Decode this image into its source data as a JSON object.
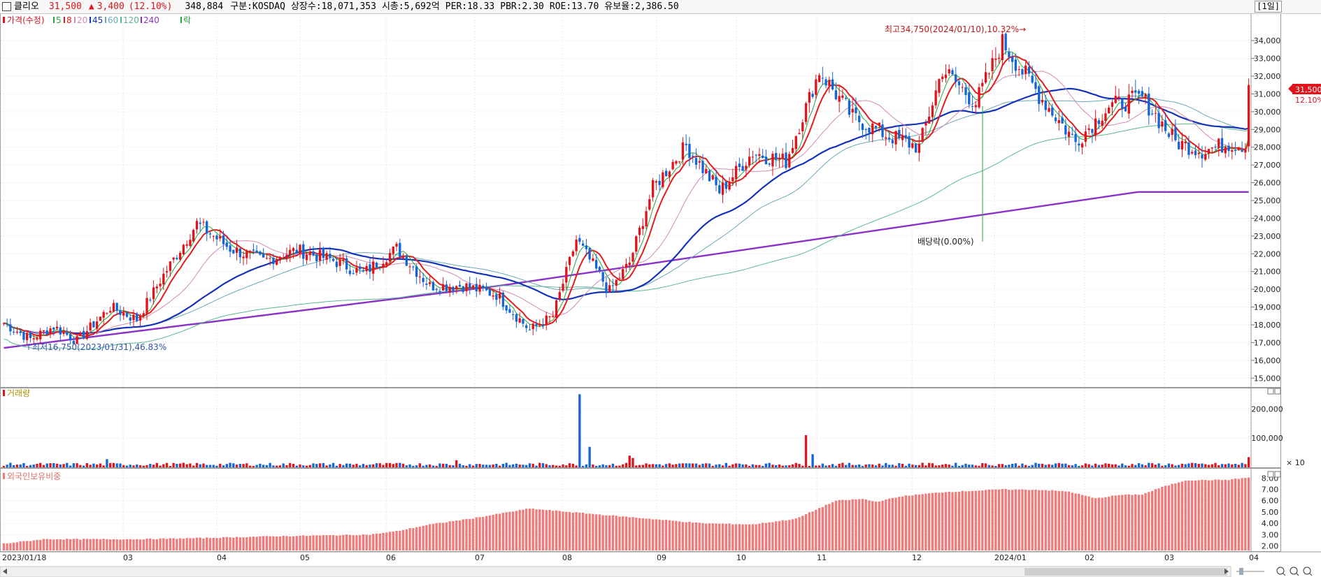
{
  "header": {
    "stock_name": "클리오",
    "price": "31,500",
    "change_arrow": "▲",
    "change": "3,400",
    "change_pct": "(12.10%)",
    "volume": "348,884",
    "market": "구분:KOSDAQ",
    "shares": "상장수:18,071,353",
    "mcap": "시총:5,692억",
    "per": "PER:18.33",
    "pbr": "PBR:2.30",
    "roe": "ROE:13.70",
    "float": "유보율:2,386.50",
    "period": "[1일]"
  },
  "colors": {
    "up": "#e0141c",
    "down": "#1466d6",
    "ma5": "#22a83a",
    "ma8": "#e41c1c",
    "ma20": "#d28ab4",
    "ma45": "#1432b8",
    "ma60": "#6aa8b8",
    "ma120": "#5cb890",
    "ma240": "#8a32c8",
    "foreign": "#f07a7a",
    "grid": "#d8d8d8"
  },
  "legend": {
    "price": "가격(수정)",
    "ma5": "5",
    "ma8": "8",
    "ma20": "20",
    "ma45": "45",
    "ma60": "60",
    "ma120": "120",
    "ma240": "240",
    "drop": "락"
  },
  "annotations": {
    "high": "최고34,750(2024/01/10),10.32%→",
    "low": "↑최저16,750(2023/01/31),46.83%",
    "dividend": "배당락(0.00%)"
  },
  "panels": {
    "volume_title": "거래량",
    "foreign_title": "외국인보유비중",
    "volume_unit": "× 10"
  },
  "chart_data": [
    {
      "type": "candlestick",
      "title": "클리오",
      "y_ticks": [
        "15,000",
        "16,000",
        "17,000",
        "18,000",
        "19,000",
        "20,000",
        "21,000",
        "22,000",
        "23,000",
        "24,000",
        "25,000",
        "26,000",
        "27,000",
        "28,000",
        "29,000",
        "30,000",
        "31,000",
        "32,000",
        "33,000",
        "34,000"
      ],
      "ylim": [
        14500,
        35500
      ],
      "x_ticks": [
        "2023/01/18",
        "03",
        "04",
        "05",
        "06",
        "07",
        "08",
        "09",
        "10",
        "11",
        "12",
        "2024/01",
        "02",
        "03",
        "04"
      ],
      "current_price_label": "31,500",
      "current_pct_label": "12.10%",
      "close_anchors": [
        [
          0,
          18100
        ],
        [
          8,
          17200
        ],
        [
          15,
          17900
        ],
        [
          22,
          17100
        ],
        [
          32,
          19000
        ],
        [
          40,
          18300
        ],
        [
          48,
          20800
        ],
        [
          58,
          23700
        ],
        [
          68,
          22300
        ],
        [
          78,
          21600
        ],
        [
          88,
          22200
        ],
        [
          98,
          21700
        ],
        [
          108,
          20900
        ],
        [
          118,
          22300
        ],
        [
          128,
          20200
        ],
        [
          138,
          20200
        ],
        [
          148,
          19700
        ],
        [
          158,
          17700
        ],
        [
          165,
          18500
        ],
        [
          172,
          22800
        ],
        [
          182,
          19900
        ],
        [
          188,
          21500
        ],
        [
          195,
          25700
        ],
        [
          205,
          28100
        ],
        [
          215,
          25500
        ],
        [
          225,
          27700
        ],
        [
          235,
          27200
        ],
        [
          245,
          32300
        ],
        [
          255,
          29700
        ],
        [
          265,
          28700
        ],
        [
          275,
          28000
        ],
        [
          282,
          32400
        ],
        [
          292,
          30500
        ],
        [
          300,
          33900
        ],
        [
          312,
          30700
        ],
        [
          322,
          28300
        ],
        [
          332,
          30300
        ],
        [
          342,
          30800
        ],
        [
          352,
          28300
        ],
        [
          360,
          27800
        ],
        [
          368,
          28200
        ],
        [
          373,
          28100
        ],
        [
          374,
          31500
        ]
      ],
      "n_days": 375
    },
    {
      "type": "bar",
      "title": "거래량",
      "y_ticks": [
        "100,000",
        "200,000"
      ],
      "ylim": [
        0,
        270000
      ],
      "spikes": [
        [
          31,
          28000
        ],
        [
          136,
          24000
        ],
        [
          173,
          250000
        ],
        [
          176,
          70000
        ],
        [
          188,
          40000
        ],
        [
          189,
          32000
        ],
        [
          241,
          110000
        ],
        [
          243,
          45000
        ],
        [
          372,
          15000
        ],
        [
          374,
          34888
        ]
      ],
      "base_level": 12000
    },
    {
      "type": "bar",
      "title": "외국인보유비중",
      "y_ticks": [
        "2.00",
        "3.00",
        "4.00",
        "5.00",
        "6.00",
        "7.00",
        "8.00"
      ],
      "ylim": [
        1.6,
        8.7
      ],
      "value_anchors": [
        [
          0,
          2.2
        ],
        [
          12,
          2.6
        ],
        [
          40,
          2.6
        ],
        [
          60,
          2.7
        ],
        [
          80,
          2.85
        ],
        [
          110,
          3.0
        ],
        [
          118,
          3.3
        ],
        [
          128,
          3.9
        ],
        [
          140,
          4.4
        ],
        [
          158,
          5.3
        ],
        [
          170,
          5.0
        ],
        [
          178,
          4.8
        ],
        [
          190,
          4.5
        ],
        [
          210,
          4.0
        ],
        [
          225,
          3.9
        ],
        [
          238,
          4.4
        ],
        [
          250,
          6.0
        ],
        [
          258,
          6.15
        ],
        [
          262,
          5.9
        ],
        [
          270,
          6.4
        ],
        [
          282,
          6.75
        ],
        [
          300,
          7.0
        ],
        [
          312,
          6.95
        ],
        [
          320,
          6.8
        ],
        [
          328,
          6.2
        ],
        [
          335,
          6.5
        ],
        [
          342,
          6.55
        ],
        [
          348,
          7.2
        ],
        [
          355,
          7.8
        ],
        [
          368,
          7.85
        ],
        [
          374,
          8.05
        ]
      ]
    }
  ]
}
